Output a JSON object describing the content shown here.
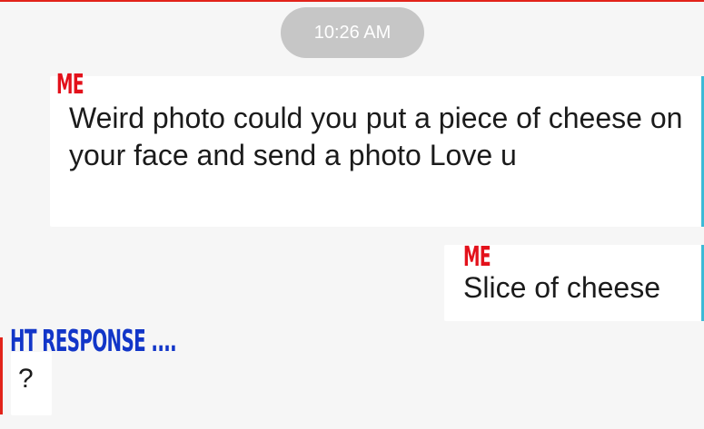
{
  "timestamp": "10:26 AM",
  "messages": [
    {
      "text": "Weird photo could you put a piece of cheese on your face and send a photo Love u"
    },
    {
      "text": "Slice of cheese"
    },
    {
      "text": "?"
    }
  ],
  "annotations": {
    "me_1": "ME",
    "me_2": "ME",
    "response": "HT  RESPONSE ...."
  },
  "colors": {
    "background": "#f6f6f6",
    "bubble": "#ffffff",
    "timestamp_pill": "#c6c6c6",
    "sent_accent": "#3dbad6",
    "received_accent": "#e2231a",
    "annotation_red": "#e3111b",
    "annotation_blue": "#1236c8"
  }
}
